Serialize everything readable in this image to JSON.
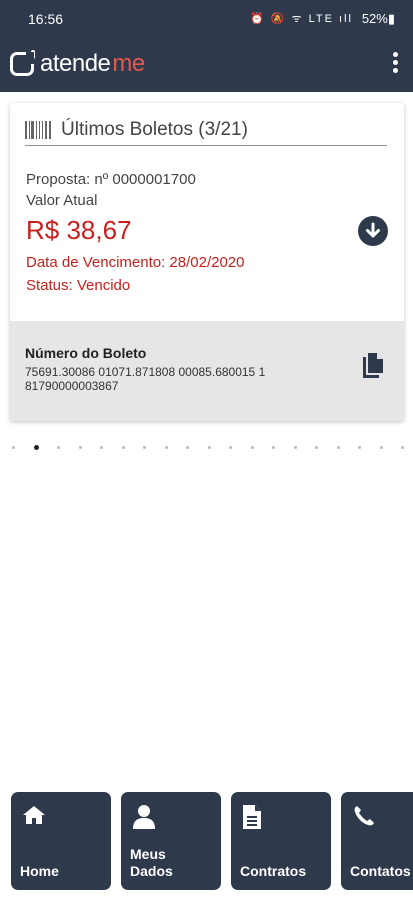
{
  "status_bar": {
    "time": "16:56",
    "icons": "⏰ 🔕 ᯤ LTE ıll",
    "battery": "52%▮"
  },
  "app": {
    "logo_part1": "atende",
    "logo_part2": "me"
  },
  "card": {
    "title": "Últimos Boletos (3/21)",
    "proposal": "Proposta: nº 0000001700",
    "value_label": "Valor Atual",
    "amount": "R$ 38,67",
    "due_date": "Data de Vencimento: 28/02/2020",
    "status": "Status: Vencido",
    "boleto_label": "Número do Boleto",
    "boleto_number": "75691.30086 01071.871808 00085.680015 1 81790000003867"
  },
  "pagination": {
    "total": 19,
    "active_index": 1
  },
  "nav": {
    "home": "Home",
    "meus_dados_1": "Meus",
    "meus_dados_2": "Dados",
    "contratos": "Contratos",
    "contatos": "Contatos"
  },
  "colors": {
    "primary": "#2e3a4c",
    "accent": "#e6574a",
    "alert": "#c8211d"
  }
}
